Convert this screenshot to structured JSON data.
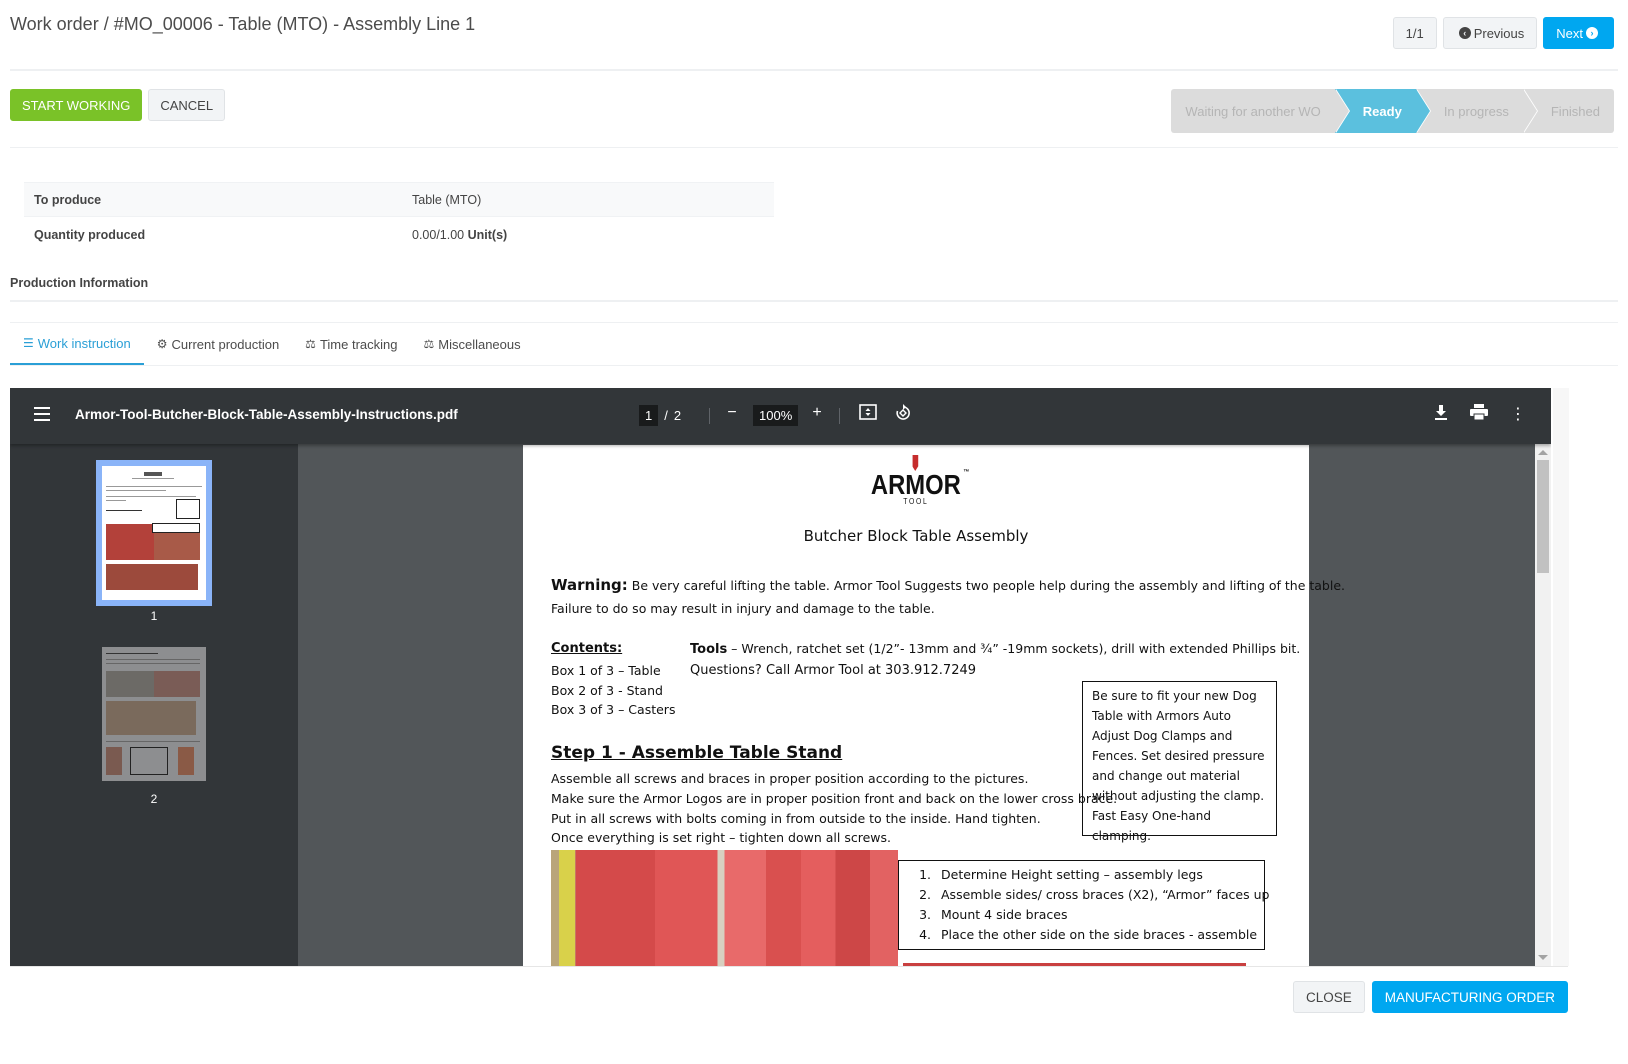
{
  "header": {
    "breadcrumb": "Work order / #MO_00006 - Table (MTO) - Assembly Line 1",
    "pager_counter": "1/1",
    "previous_label": "Previous",
    "next_label": "Next"
  },
  "actions": {
    "start_working": "START WORKING",
    "cancel": "CANCEL"
  },
  "statusbar": {
    "stages": [
      {
        "label": "Waiting for another WO",
        "active": false
      },
      {
        "label": "Ready",
        "active": true
      },
      {
        "label": "In progress",
        "active": false
      },
      {
        "label": "Finished",
        "active": false
      }
    ]
  },
  "info": {
    "to_produce_label": "To produce",
    "to_produce_value": "Table (MTO)",
    "qty_label": "Quantity produced",
    "qty_value": "0.00/1.00",
    "qty_unit": "Unit(s)"
  },
  "section_title": "Production Information",
  "tabs": [
    {
      "label": "Work instruction",
      "icon": "list-icon",
      "active": true
    },
    {
      "label": "Current production",
      "icon": "gears-icon",
      "active": false
    },
    {
      "label": "Time tracking",
      "icon": "balance-scale-icon",
      "active": false
    },
    {
      "label": "Miscellaneous",
      "icon": "balance-scale-icon",
      "active": false
    }
  ],
  "pdf": {
    "filename": "Armor-Tool-Butcher-Block-Table-Assembly-Instructions.pdf",
    "current_page": "1",
    "page_separator": "/",
    "total_pages": "2",
    "zoom": "100%",
    "thumbnails": [
      "1",
      "2"
    ],
    "document": {
      "logo_text": "ARMOR",
      "logo_sub": "TOOL",
      "logo_tm": "™",
      "title": "Butcher Block Table Assembly",
      "warning_label": "Warning:",
      "warning_text": " Be very careful lifting the table.  Armor Tool Suggests two people help during the assembly and lifting of the table.",
      "warning_text2": "Failure to do so may result in injury and damage to the table.",
      "contents_label": "Contents:",
      "tools_label": "Tools",
      "tools_text": " – Wrench, ratchet set (1/2”- 13mm and ¾” -19mm sockets), drill with extended Phillips bit.",
      "box1": "Box 1 of 3 – Table",
      "box2": "Box 2 of 3 - Stand",
      "box3": "Box 3 of 3 – Casters",
      "questions": "Questions?  Call Armor Tool at 303.912.7249",
      "side_note": "Be sure to fit your new Dog Table with Armors Auto Adjust Dog Clamps and Fences.   Set desired pressure and change out material without adjusting the clamp. Fast Easy One-hand clamping.",
      "step_title": "Step 1 - Assemble Table Stand",
      "step_lines": [
        "Assemble all screws and braces in proper position according to the pictures.",
        "Make sure the Armor Logos are in proper position front and back on the lower cross brace.",
        "Put in all screws with bolts coming in from outside to the inside.   Hand tighten.",
        "Once everything is set right – tighten down all screws."
      ],
      "numbered_steps": [
        {
          "n": "1.",
          "text": "Determine Height setting – assembly legs"
        },
        {
          "n": "2.",
          "text": "Assemble sides/ cross braces (X2), “Armor” faces up"
        },
        {
          "n": "3.",
          "text": "Mount 4 side braces"
        },
        {
          "n": "4.",
          "text": "Place the other side on the side braces - assemble"
        }
      ]
    }
  },
  "footer": {
    "close": "CLOSE",
    "manufacturing_order": "MANUFACTURING ORDER"
  }
}
